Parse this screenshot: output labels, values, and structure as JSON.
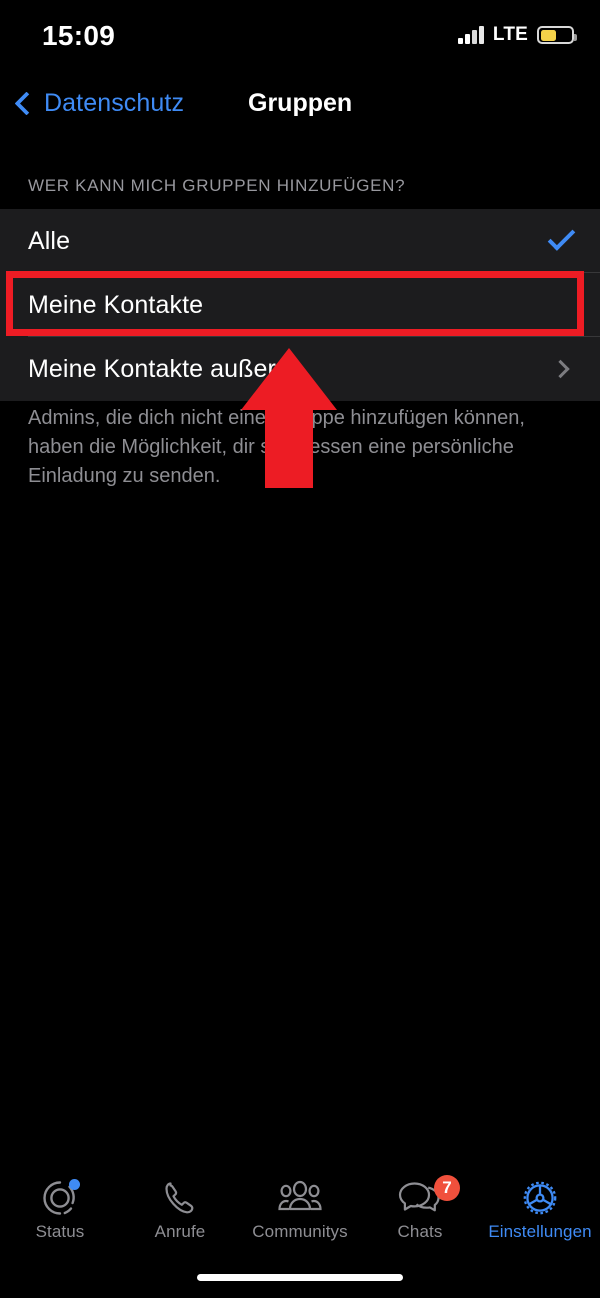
{
  "status_bar": {
    "time": "15:09",
    "network_label": "LTE",
    "signal_icon": "cellular-signal-icon",
    "battery_icon": "battery-icon",
    "battery_color": "#f5d249",
    "battery_level_percent": 52
  },
  "nav_bar": {
    "back_label": "Datenschutz",
    "back_icon": "chevron-left-icon",
    "title": "Gruppen",
    "accent_color": "#3f8bf5"
  },
  "section": {
    "header": "WER KANN MICH GRUPPEN HINZUFÜGEN?",
    "rows": [
      {
        "label": "Alle",
        "accessory": "checkmark",
        "selected": true
      },
      {
        "label": "Meine Kontakte",
        "accessory": "none",
        "selected": false
      },
      {
        "label": "Meine Kontakte außer ...",
        "accessory": "chevron",
        "selected": false
      }
    ],
    "footer_note": "Admins, die dich nicht einer Gruppe hinzufügen können, haben die Möglichkeit, dir stattdessen eine persönliche Einladung zu senden."
  },
  "annotations": {
    "highlight_box_color": "#ed1c24",
    "arrow_color": "#ed1c24",
    "arrow_icon": "arrow-up-icon",
    "highlight_target": "Meine Kontakte"
  },
  "tab_bar": {
    "items": [
      {
        "label": "Status",
        "icon": "status-rings-icon",
        "active": false,
        "dot": true
      },
      {
        "label": "Anrufe",
        "icon": "phone-icon",
        "active": false
      },
      {
        "label": "Communitys",
        "icon": "community-people-icon",
        "active": false
      },
      {
        "label": "Chats",
        "icon": "chat-bubbles-icon",
        "active": false,
        "badge": "7"
      },
      {
        "label": "Einstellungen",
        "icon": "gear-icon",
        "active": true
      }
    ],
    "active_color": "#3f8bf5",
    "inactive_color": "#8e8e93",
    "badge_color": "#f0503c"
  },
  "home_indicator": "home-indicator"
}
